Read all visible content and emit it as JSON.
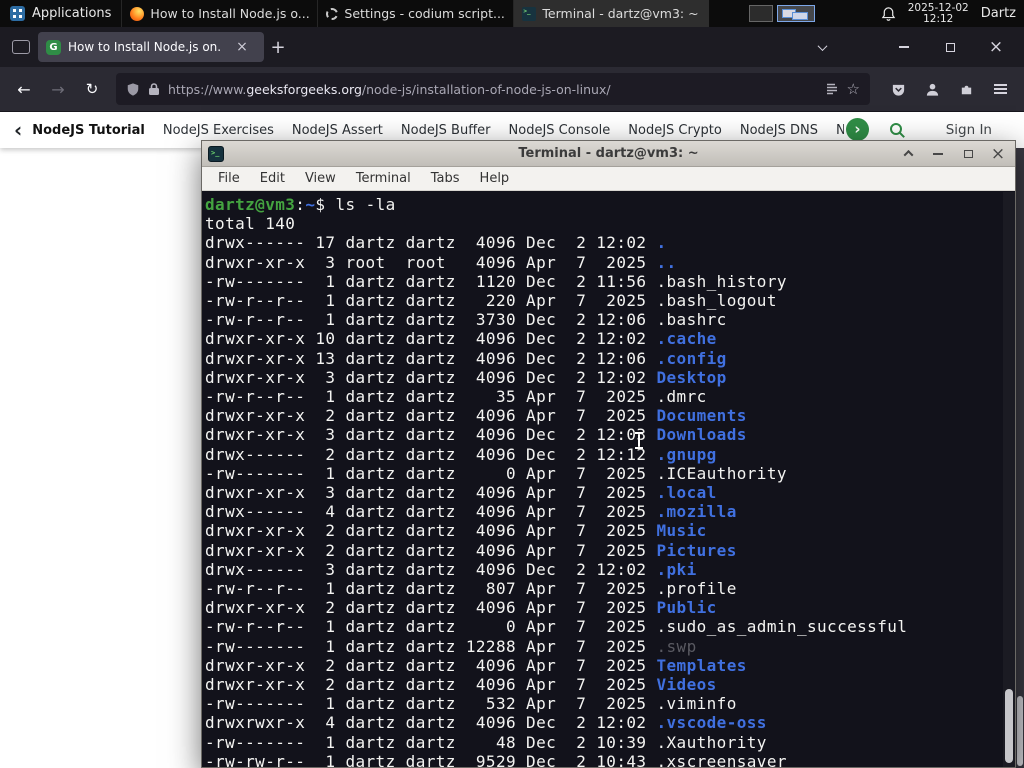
{
  "colors": {
    "panel_bg": "#0c0c0c",
    "ff_tabbar": "#1c1b22",
    "ff_toolbar": "#2b2a33",
    "ff_tab": "#42414d",
    "gfg_green": "#2f8d46",
    "term_bg": "#12121b",
    "term_fg": "#f4f4f2",
    "term_green": "#44a340",
    "term_blue": "#4070e0",
    "term_dim": "#5a5a62"
  },
  "panel": {
    "applications": "Applications",
    "tasks": [
      {
        "title": "How to Install Node.js o...",
        "icon": "firefox",
        "active": false
      },
      {
        "title": "Settings - codium script...",
        "icon": "gear",
        "active": false
      },
      {
        "title": "Terminal - dartz@vm3: ~",
        "icon": "terminal",
        "active": true
      }
    ],
    "clock": {
      "date": "2025-12-02",
      "time": "12:12"
    },
    "user": "Dartz"
  },
  "browser": {
    "tab": {
      "title": "How to Install Node.js on..."
    },
    "url": {
      "prefix": "https://www.",
      "domain": "geeksforgeeks.org",
      "path": "/node-js/installation-of-node-js-on-linux/"
    },
    "gfg_nav": {
      "items": [
        {
          "label": "NodeJS Tutorial",
          "active": true
        },
        {
          "label": "NodeJS Exercises",
          "active": false
        },
        {
          "label": "NodeJS Assert",
          "active": false
        },
        {
          "label": "NodeJS Buffer",
          "active": false
        },
        {
          "label": "NodeJS Console",
          "active": false
        },
        {
          "label": "NodeJS Crypto",
          "active": false
        },
        {
          "label": "NodeJS DNS",
          "active": false
        },
        {
          "label": "Node",
          "active": false
        }
      ],
      "sign_in": "Sign In"
    }
  },
  "terminal": {
    "title": "Terminal - dartz@vm3: ~",
    "menu": [
      "File",
      "Edit",
      "View",
      "Terminal",
      "Tabs",
      "Help"
    ],
    "prompt_parts": [
      {
        "t": "dartz@vm3",
        "c": "green"
      },
      {
        "t": ":",
        "c": "fg"
      },
      {
        "t": "~",
        "c": "blue"
      },
      {
        "t": "$ ",
        "c": "fg"
      },
      {
        "t": "ls -la",
        "c": "fg"
      }
    ],
    "total_line": "total 140",
    "listing": [
      [
        "drwx------ 17 dartz dartz  4096 Dec  2 12:02 ",
        ".",
        "dir"
      ],
      [
        "drwxr-xr-x  3 root  root   4096 Apr  7  2025 ",
        "..",
        "dir"
      ],
      [
        "-rw-------  1 dartz dartz  1120 Dec  2 11:56 ",
        ".bash_history",
        "file"
      ],
      [
        "-rw-r--r--  1 dartz dartz   220 Apr  7  2025 ",
        ".bash_logout",
        "file"
      ],
      [
        "-rw-r--r--  1 dartz dartz  3730 Dec  2 12:06 ",
        ".bashrc",
        "file"
      ],
      [
        "drwxr-xr-x 10 dartz dartz  4096 Dec  2 12:02 ",
        ".cache",
        "dir"
      ],
      [
        "drwxr-xr-x 13 dartz dartz  4096 Dec  2 12:06 ",
        ".config",
        "dir"
      ],
      [
        "drwxr-xr-x  3 dartz dartz  4096 Dec  2 12:02 ",
        "Desktop",
        "dir"
      ],
      [
        "-rw-r--r--  1 dartz dartz    35 Apr  7  2025 ",
        ".dmrc",
        "file"
      ],
      [
        "drwxr-xr-x  2 dartz dartz  4096 Apr  7  2025 ",
        "Documents",
        "dir"
      ],
      [
        "drwxr-xr-x  3 dartz dartz  4096 Dec  2 12:03 ",
        "Downloads",
        "dir"
      ],
      [
        "drwx------  2 dartz dartz  4096 Dec  2 12:12 ",
        ".gnupg",
        "dir"
      ],
      [
        "-rw-------  1 dartz dartz     0 Apr  7  2025 ",
        ".ICEauthority",
        "file"
      ],
      [
        "drwxr-xr-x  3 dartz dartz  4096 Apr  7  2025 ",
        ".local",
        "dir"
      ],
      [
        "drwx------  4 dartz dartz  4096 Apr  7  2025 ",
        ".mozilla",
        "dir"
      ],
      [
        "drwxr-xr-x  2 dartz dartz  4096 Apr  7  2025 ",
        "Music",
        "dir"
      ],
      [
        "drwxr-xr-x  2 dartz dartz  4096 Apr  7  2025 ",
        "Pictures",
        "dir"
      ],
      [
        "drwx------  3 dartz dartz  4096 Dec  2 12:02 ",
        ".pki",
        "dir"
      ],
      [
        "-rw-r--r--  1 dartz dartz   807 Apr  7  2025 ",
        ".profile",
        "file"
      ],
      [
        "drwxr-xr-x  2 dartz dartz  4096 Apr  7  2025 ",
        "Public",
        "dir"
      ],
      [
        "-rw-r--r--  1 dartz dartz     0 Apr  7  2025 ",
        ".sudo_as_admin_successful",
        "file"
      ],
      [
        "-rw-------  1 dartz dartz 12288 Apr  7  2025 ",
        ".swp",
        "dim"
      ],
      [
        "drwxr-xr-x  2 dartz dartz  4096 Apr  7  2025 ",
        "Templates",
        "dir"
      ],
      [
        "drwxr-xr-x  2 dartz dartz  4096 Apr  7  2025 ",
        "Videos",
        "dir"
      ],
      [
        "-rw-------  1 dartz dartz   532 Apr  7  2025 ",
        ".viminfo",
        "file"
      ],
      [
        "drwxrwxr-x  4 dartz dartz  4096 Dec  2 12:02 ",
        ".vscode-oss",
        "dir"
      ],
      [
        "-rw-------  1 dartz dartz    48 Dec  2 10:39 ",
        ".Xauthority",
        "file"
      ],
      [
        "-rw-rw-r--  1 dartz dartz  9529 Dec  2 10:43 ",
        ".xscreensaver",
        "file"
      ]
    ]
  }
}
